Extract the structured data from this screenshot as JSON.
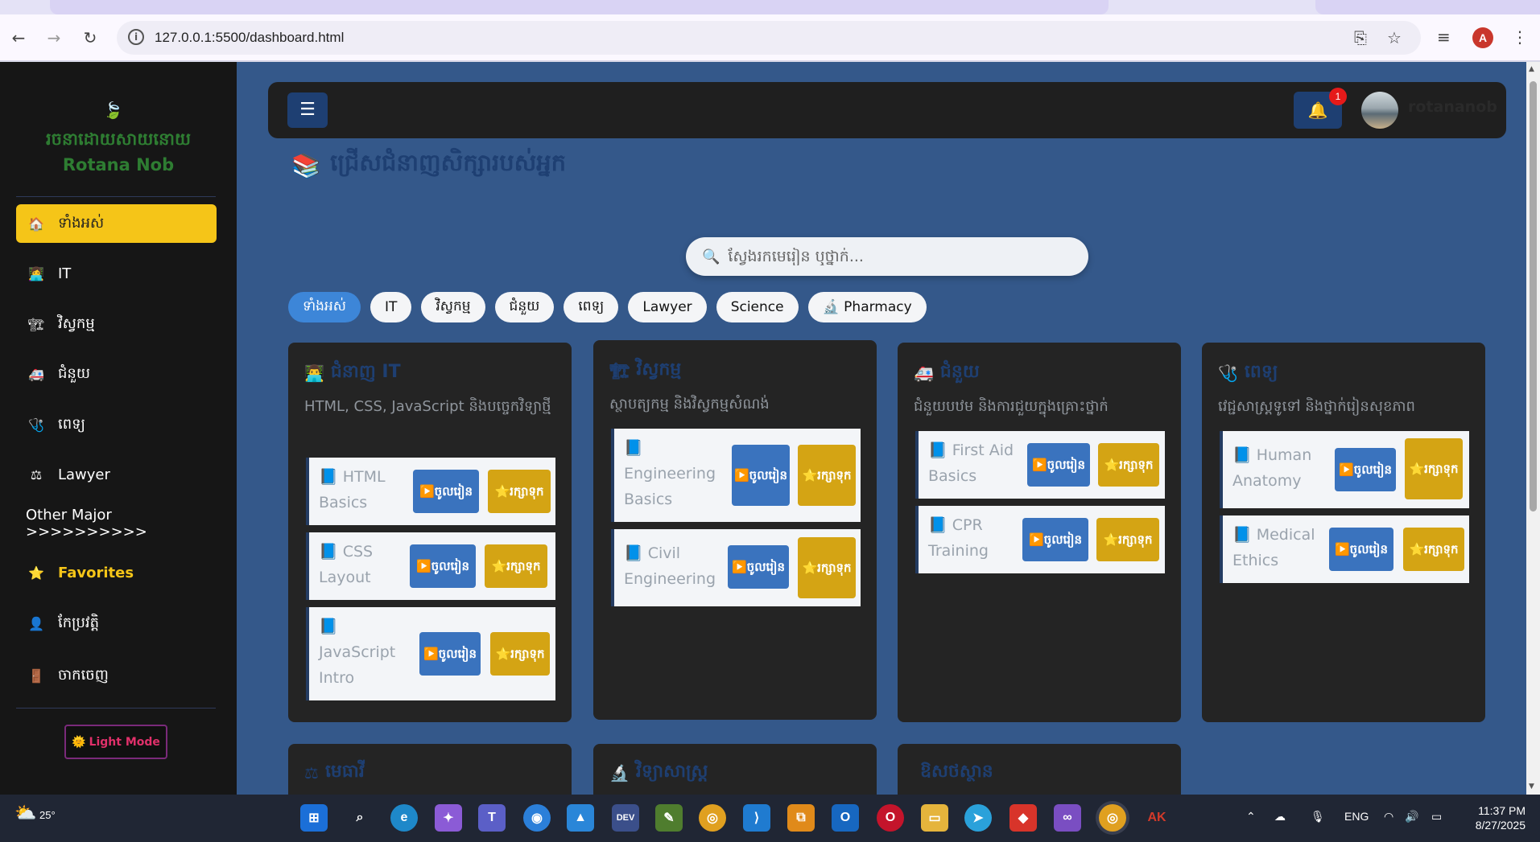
{
  "browser": {
    "url": "127.0.0.1:5500/dashboard.html",
    "profile_initial": "A"
  },
  "sidebar": {
    "logo_icon": "🍃",
    "brand_line1": "រចនាដោយសាយនោយ",
    "brand_line2": "Rotana Nob",
    "items": [
      {
        "icon": "🏠",
        "label": "ទាំងអស់"
      },
      {
        "icon": "👩‍💻",
        "label": "IT"
      },
      {
        "icon": "🏗",
        "label": "វិស្វកម្ម"
      },
      {
        "icon": "🚑",
        "label": "ជំនួយ"
      },
      {
        "icon": "🩺",
        "label": "ពេទ្យ"
      },
      {
        "icon": "⚖",
        "label": "Lawyer"
      },
      {
        "icon": "",
        "label": "Other Major >>>>>>>>>>"
      },
      {
        "icon": "⭐",
        "label": "Favorites"
      },
      {
        "icon": "👤",
        "label": "កែប្រវត្តិ"
      },
      {
        "icon": "🚪",
        "label": "ចាកចេញ"
      }
    ],
    "light_mode_icon": "🌞",
    "light_mode_label": "Light Mode"
  },
  "topbar": {
    "menu_icon": "☰",
    "bell_icon": "🔔",
    "notification_count": "1",
    "username": "rotananob"
  },
  "main": {
    "heading_icon": "📚",
    "heading": "ជ្រើសជំនាញសិក្សារបស់អ្នក",
    "search_icon": "🔍",
    "search_placeholder": "ស្វែងរកមេរៀន ឬថ្នាក់...",
    "filters": [
      "ទាំងអស់",
      "IT",
      "វិស្វកម្ម",
      "ជំនួយ",
      "ពេទ្យ",
      "Lawyer",
      "Science",
      "🔬 Pharmacy"
    ],
    "lesson_icon": "📘",
    "enter_icon": "▶️",
    "save_icon": "⭐",
    "cards": [
      {
        "icon": "👨‍💻",
        "title": "ជំនាញ IT",
        "desc": "HTML, CSS, JavaScript និងបច្ចេកវិទ្យាថ្មី",
        "lessons": [
          {
            "name": "HTML Basics",
            "enter": "ចូលរៀន",
            "save": "រក្សាទុក"
          },
          {
            "name": "CSS Layout",
            "enter": "ចូលរៀន",
            "save": "រក្សាទុក"
          },
          {
            "name": "JavaScript Intro",
            "enter": "ចូលរៀន",
            "save": "រក្សាទុក"
          }
        ]
      },
      {
        "icon": "🏗",
        "title": "វិស្វកម្ម",
        "desc": "ស្ថាបត្យកម្ម និងវិស្វកម្មសំណង់",
        "lessons": [
          {
            "name": "Engineering Basics",
            "enter": "ចូលរៀន",
            "save": "រក្សាទុក"
          },
          {
            "name": "Civil Engineering",
            "enter": "ចូលរៀន",
            "save": "រក្សាទុក"
          }
        ]
      },
      {
        "icon": "🚑",
        "title": "ជំនួយ",
        "desc": "ជំនួយបឋម និងការជួយក្នុងគ្រោះថ្នាក់",
        "lessons": [
          {
            "name": "First Aid Basics",
            "enter": "ចូលរៀន",
            "save": "រក្សាទុក"
          },
          {
            "name": "CPR Training",
            "enter": "ចូលរៀន",
            "save": "រក្សាទុក"
          }
        ]
      },
      {
        "icon": "🩺",
        "title": "ពេទ្យ",
        "desc": "វេជ្ជសាស្ត្រទូទៅ និងថ្នាក់រៀនសុខភាព",
        "lessons": [
          {
            "name": "Human Anatomy",
            "enter": "ចូលរៀន",
            "save": "រក្សាទុក"
          },
          {
            "name": "Medical Ethics",
            "enter": "ចូលរៀន",
            "save": "រក្សាទុក"
          }
        ]
      },
      {
        "icon": "⚖",
        "title": "មេធាវី"
      },
      {
        "icon": "🔬",
        "title": "វិទ្យាសាស្ត្រ"
      },
      {
        "icon": "",
        "title": "ឱសថស្ថាន"
      }
    ]
  },
  "taskbar": {
    "weather_temp": "25°",
    "weather_icon": "⛅",
    "tray_lang": "ENG",
    "time": "11:37 PM",
    "date": "8/27/2025"
  }
}
